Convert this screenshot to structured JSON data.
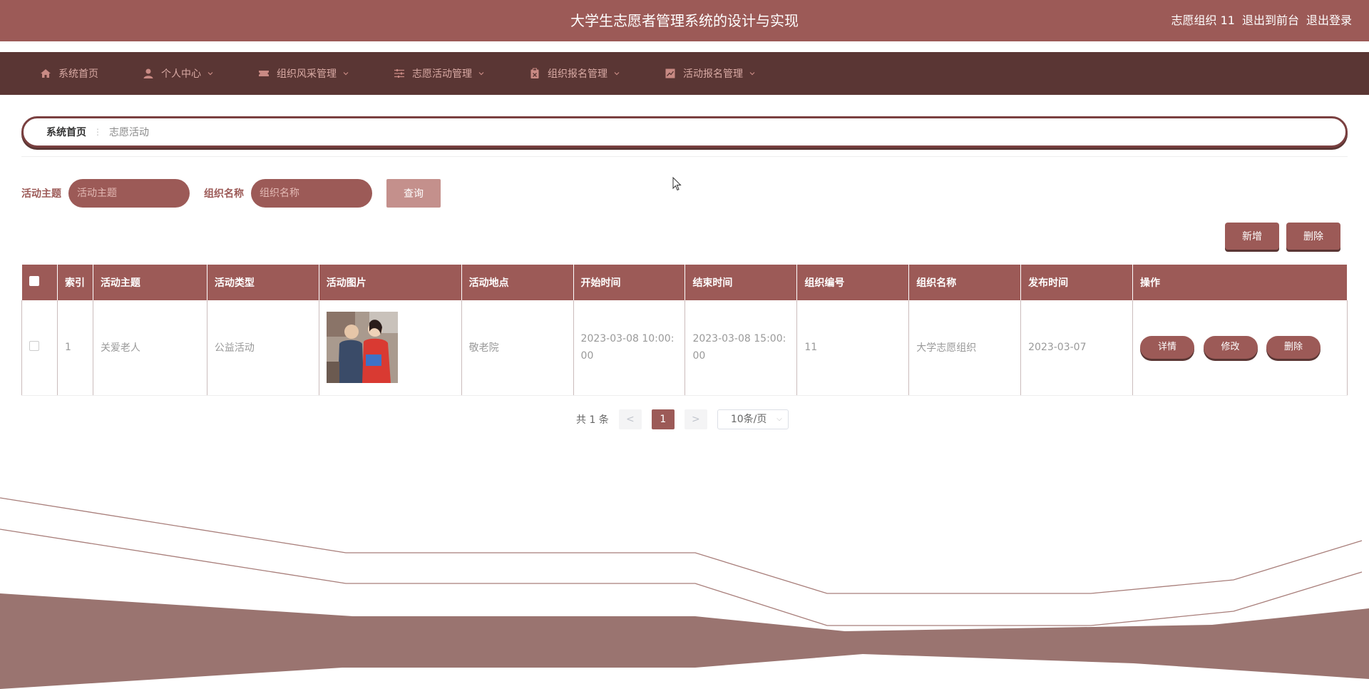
{
  "header": {
    "title": "大学生志愿者管理系统的设计与实现",
    "user": "志愿组织 11",
    "front": "退出到前台",
    "logout": "退出登录"
  },
  "nav": {
    "items": [
      {
        "label": "系统首页",
        "icon": "home-icon"
      },
      {
        "label": "个人中心",
        "icon": "user-icon"
      },
      {
        "label": "组织风采管理",
        "icon": "ticket-icon"
      },
      {
        "label": "志愿活动管理",
        "icon": "sliders-icon"
      },
      {
        "label": "组织报名管理",
        "icon": "clipboard-icon"
      },
      {
        "label": "活动报名管理",
        "icon": "chart-icon"
      }
    ]
  },
  "breadcrumb": {
    "home": "系统首页",
    "separator": "⋮",
    "current": "志愿活动"
  },
  "search": {
    "topic_label": "活动主题",
    "topic_placeholder": "活动主题",
    "org_label": "组织名称",
    "org_placeholder": "组织名称",
    "query": "查询"
  },
  "actions": {
    "add": "新增",
    "delete": "删除"
  },
  "table": {
    "headers": [
      "索引",
      "活动主题",
      "活动类型",
      "活动图片",
      "活动地点",
      "开始时间",
      "结束时间",
      "组织编号",
      "组织名称",
      "发布时间",
      "操作"
    ],
    "rows": [
      {
        "index": "1",
        "topic": "关爱老人",
        "type": "公益活动",
        "place": "敬老院",
        "start": "2023-03-08 10:00:00",
        "end": "2023-03-08 15:00:00",
        "org_no": "11",
        "org_name": "大学志愿组织",
        "publish": "2023-03-07",
        "ops": {
          "detail": "详情",
          "edit": "修改",
          "delete": "删除"
        }
      }
    ]
  },
  "pager": {
    "total": "共 1 条",
    "prev": "<",
    "page": "1",
    "next": ">",
    "size": "10条/页"
  },
  "colors": {
    "primary": "#9c5a57",
    "dark": "#5a3634"
  }
}
